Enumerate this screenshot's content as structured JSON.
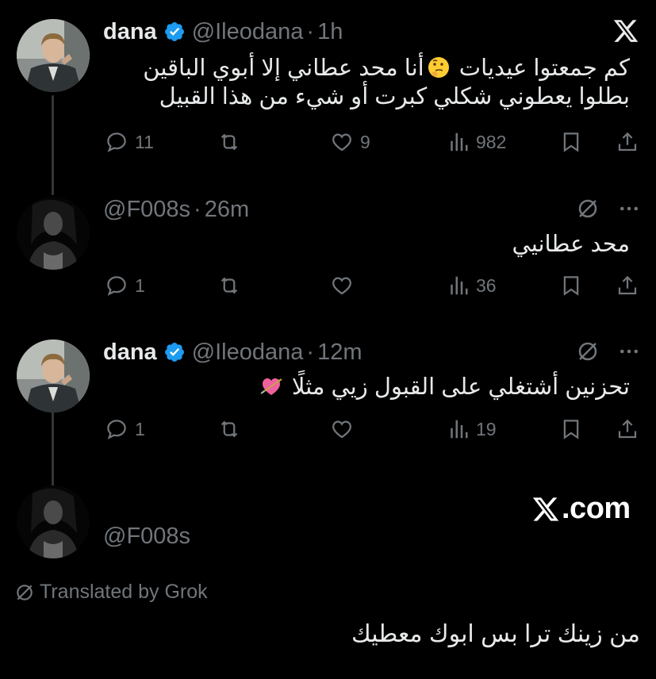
{
  "brand": {
    "logo_icon": "x-logo-icon",
    "watermark_text": ".com"
  },
  "colors": {
    "background": "#000000",
    "text": "#e7e9ea",
    "muted": "#71767b",
    "verified": "#1d9bf0",
    "thread_line": "#333639"
  },
  "posts": [
    {
      "name": "dana",
      "verified": true,
      "handle": "@Ileodana",
      "separator": "·",
      "time": "1h",
      "lines": [
        "كم جمعتوا عيديات 🤔أنا محد عطاني إلا أبوي الباقين",
        "بطلوا يعطوني شكلي كبرت أو شيء من هذا القبيل"
      ],
      "replies": "11",
      "reposts": "",
      "likes": "9",
      "views": "982"
    },
    {
      "handle": "@F008s",
      "separator": "·",
      "time": "26m",
      "lines": [
        "محد عطانيي"
      ],
      "replies": "1",
      "reposts": "",
      "likes": "",
      "views": "36"
    },
    {
      "name": "dana",
      "verified": true,
      "handle": "@Ileodana",
      "separator": "·",
      "time": "12m",
      "lines": [
        "تحزنين أشتغلي على القبول زيي مثلًا 💘"
      ],
      "replies": "1",
      "reposts": "",
      "likes": "",
      "views": "19"
    }
  ],
  "quoted_reply": {
    "handle": "@F008s",
    "translated_label": "Translated by Grok",
    "translated_text": "من زينك ترا بس ابوك معطيك"
  },
  "icons": [
    "reply-icon",
    "repost-icon",
    "like-icon",
    "views-icon",
    "bookmark-icon",
    "share-icon",
    "grok-icon",
    "more-icon",
    "verified-badge-icon",
    "thinking-face-emoji",
    "heart-with-arrow-emoji"
  ]
}
